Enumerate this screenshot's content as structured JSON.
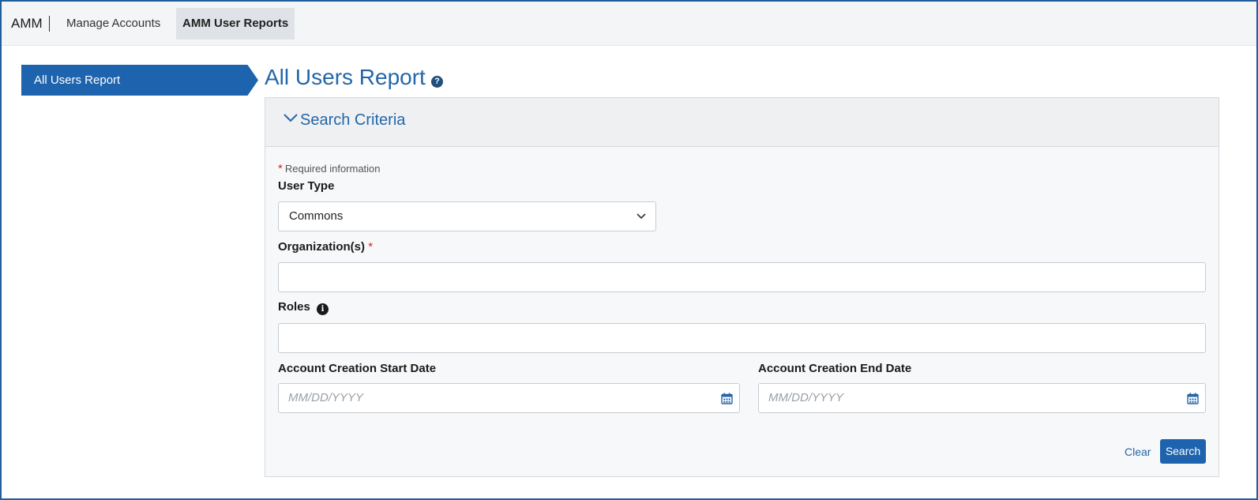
{
  "topnav": {
    "brand": "AMM",
    "items": [
      {
        "label": "Manage Accounts"
      },
      {
        "label": "AMM User Reports",
        "active": true
      }
    ]
  },
  "sidebar": {
    "items": [
      {
        "label": "All Users Report",
        "active": true
      }
    ]
  },
  "main": {
    "title": "All Users Report",
    "help_icon": "question-circle-icon",
    "panel": {
      "title": "Search Criteria",
      "required_note": "Required information",
      "user_type": {
        "label": "User Type",
        "value": "Commons"
      },
      "organizations": {
        "label": "Organization(s)",
        "value": ""
      },
      "roles": {
        "label": "Roles",
        "value": ""
      },
      "start_date": {
        "label": "Account Creation Start Date",
        "placeholder": "MM/DD/YYYY"
      },
      "end_date": {
        "label": "Account Creation End Date",
        "placeholder": "MM/DD/YYYY"
      },
      "clear_label": "Clear",
      "search_label": "Search"
    }
  },
  "colors": {
    "accent": "#1e63ad",
    "title": "#2466a8",
    "required": "#d9232d"
  }
}
